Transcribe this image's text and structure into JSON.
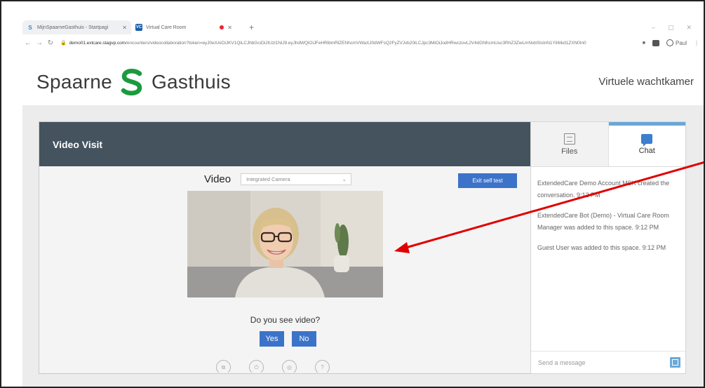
{
  "browser": {
    "tabs": [
      {
        "title": "MijnSpaarneGasthuis - Startpagi",
        "icon": "S"
      },
      {
        "title": "Virtual Care Room",
        "icon": "VC"
      }
    ],
    "new_tab": "+",
    "window_controls": [
      "–",
      "▢",
      "✕"
    ],
    "url_host": "demo01.extcare.stagvp.com",
    "url_path": "/encounters/videocollaboration?token=eyJ0eXAiOiJKV1QiLCJhbGciOiJIUzI1NiJ9.eyJhdWQiOiJFeHRlbmRlZENhcmVWaXJ0dWFsQ2FyZVJvb20iLCJpc3MiOiJodHRwczovL2V4dGNhcmUuc3RhZ3ZwLmNvbSIsInN1YiI6Ikd1ZXN0In0",
    "profile_label": "Paul"
  },
  "site": {
    "logo_left": "Spaarne",
    "logo_right": "Gasthuis",
    "header_link": "Virtuele wachtkamer"
  },
  "visit": {
    "title": "Video Visit",
    "video_label": "Video",
    "camera_selected": "Integrated Camera",
    "exit_button": "Exit self test",
    "question": "Do you see video?",
    "yes": "Yes",
    "no": "No"
  },
  "side": {
    "tab_files": "Files",
    "tab_chat": "Chat",
    "messages": [
      "ExtendedCare Demo Account MSK created the conversation. 9:12 PM",
      "ExtendedCare Bot (Demo) - Virtual Care Room Manager was added to this space. 9:12 PM",
      "Guest User was added to this space. 9:12 PM"
    ],
    "compose_placeholder": "Send a message"
  },
  "colors": {
    "header_bar": "#44535e",
    "button_blue": "#3b73c9",
    "chat_accent": "#6aa6da",
    "annotation_arrow": "#e00000"
  }
}
